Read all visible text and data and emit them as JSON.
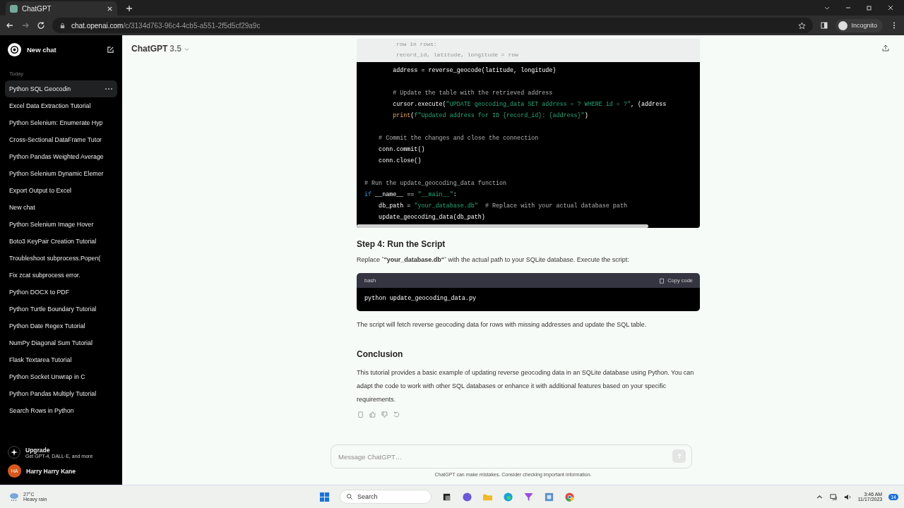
{
  "browser": {
    "tab_title": "ChatGPT",
    "url_host": "chat.openai.com",
    "url_path": "/c/3134d763-96c4-4cb5-a551-2f5d5cf29a9c",
    "profile": "Incognito"
  },
  "sidebar": {
    "new_chat": "New chat",
    "section": "Today",
    "items": [
      {
        "label": "Python SQL Geocodin",
        "selected": true
      },
      {
        "label": "Excel Data Extraction Tutorial",
        "selected": false
      },
      {
        "label": "Python Selenium: Enumerate Hyp",
        "selected": false
      },
      {
        "label": "Cross-Sectional DataFrame Tutor",
        "selected": false
      },
      {
        "label": "Python Pandas Weighted Average",
        "selected": false
      },
      {
        "label": "Python Selenium Dynamic Elemer",
        "selected": false
      },
      {
        "label": "Export Output to Excel",
        "selected": false
      },
      {
        "label": "New chat",
        "selected": false
      },
      {
        "label": "Python Selenium Image Hover",
        "selected": false
      },
      {
        "label": "Boto3 KeyPair Creation Tutorial",
        "selected": false
      },
      {
        "label": "Troubleshoot subprocess.Popen(",
        "selected": false
      },
      {
        "label": "Fix zcat subprocess error.",
        "selected": false
      },
      {
        "label": "Python DOCX to PDF",
        "selected": false
      },
      {
        "label": "Python Turtle Boundary Tutorial",
        "selected": false
      },
      {
        "label": "Python Date Regex Tutorial",
        "selected": false
      },
      {
        "label": "NumPy Diagonal Sum Tutorial",
        "selected": false
      },
      {
        "label": "Flask Textarea Tutorial",
        "selected": false
      },
      {
        "label": "Python Socket Unwrap in C",
        "selected": false
      },
      {
        "label": "Python Pandas Multiply Tutorial",
        "selected": false
      },
      {
        "label": "Search Rows in Python",
        "selected": false
      }
    ],
    "upgrade": {
      "title": "Upgrade",
      "subtitle": "Get GPT-4, DALL·E, and more"
    },
    "user": {
      "initials": "HA",
      "name": "Harry Harry Kane"
    }
  },
  "header": {
    "model": "ChatGPT",
    "version": "3.5"
  },
  "code_faded": [
    "row in rows:",
    "record_id, latitude, longitude = row"
  ],
  "code": [
    {
      "lines": [
        [
          {
            "kind": "plain",
            "text": "        address = reverse_geocode(latitude, longitude)"
          }
        ]
      ]
    },
    {
      "lines": [
        [
          {
            "kind": "comment",
            "text": "        # Update the table with the retrieved address"
          }
        ],
        [
          {
            "kind": "plain",
            "text": "        cursor.execute("
          },
          {
            "kind": "string",
            "text": "\"UPDATE geocoding_data SET address = ? WHERE id = ?\""
          },
          {
            "kind": "plain",
            "text": ", (address"
          }
        ],
        [
          {
            "kind": "func",
            "text": "        print"
          },
          {
            "kind": "plain",
            "text": "("
          },
          {
            "kind": "string",
            "text": "f\"Updated address for ID {record_id}: {address}\""
          },
          {
            "kind": "plain",
            "text": ")"
          }
        ]
      ]
    },
    {
      "lines": [
        [
          {
            "kind": "comment",
            "text": "    # Commit the changes and close the connection"
          }
        ],
        [
          {
            "kind": "plain",
            "text": "    conn.commit()"
          }
        ],
        [
          {
            "kind": "plain",
            "text": "    conn.close()"
          }
        ]
      ]
    },
    {
      "lines": [
        [
          {
            "kind": "comment",
            "text": "# Run the update_geocoding_data function"
          }
        ],
        [
          {
            "kind": "keyword",
            "text": "if"
          },
          {
            "kind": "plain",
            "text": " __name__ == "
          },
          {
            "kind": "string",
            "text": "\"__main__\""
          },
          {
            "kind": "plain",
            "text": ":"
          }
        ],
        [
          {
            "kind": "plain",
            "text": "    db_path = "
          },
          {
            "kind": "string",
            "text": "\"your_database.db\""
          },
          {
            "kind": "comment",
            "text": "  # Replace with your actual database path"
          }
        ],
        [
          {
            "kind": "plain",
            "text": "    update_geocoding_data(db_path)"
          }
        ]
      ]
    }
  ],
  "step4": {
    "heading": "Step 4: Run the Script",
    "text": "Replace **`\"your_database.db\"`** with the actual path to your SQLite database. Execute the script:"
  },
  "bash": {
    "lang": "bash",
    "copy": "Copy code",
    "code": "python update_geocoding_data.py"
  },
  "after_bash": "The script will fetch reverse geocoding data for rows with missing addresses and update the SQL table.",
  "conclusion": {
    "heading": "Conclusion",
    "text": "This tutorial provides a basic example of updating reverse geocoding data in an SQLite database using Python. You can adapt the code to work with other SQL databases or enhance it with additional features based on your specific requirements."
  },
  "composer": {
    "placeholder": "Message ChatGPT…"
  },
  "disclaimer": "ChatGPT can make mistakes. Consider checking important information.",
  "taskbar": {
    "temp": "27°C",
    "weather": "Heavy rain",
    "search": "Search",
    "time": "3:46 AM",
    "date": "11/17/2023",
    "badge": "14"
  }
}
